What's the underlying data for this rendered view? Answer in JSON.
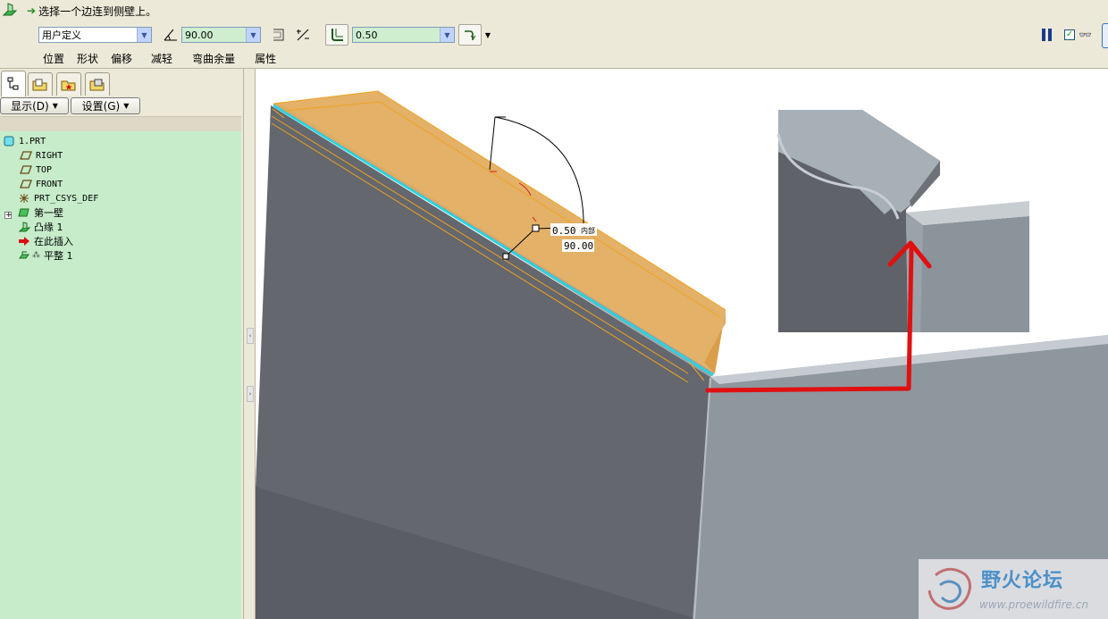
{
  "dashboard": {
    "prompt": "选择一个边连到侧壁上。",
    "shape_select": "用户定义",
    "angle_value": "90.00",
    "thickness_value": "0.50",
    "tabs": [
      "位置",
      "形状",
      "偏移",
      "减轻",
      "弯曲余量",
      "属性"
    ]
  },
  "navigator": {
    "show_button": "显示(D)",
    "settings_button": "设置(G)",
    "tree": [
      {
        "label": "1.PRT",
        "icon": "part-icon"
      },
      {
        "label": "RIGHT",
        "icon": "datum-plane-icon"
      },
      {
        "label": "TOP",
        "icon": "datum-plane-icon"
      },
      {
        "label": "FRONT",
        "icon": "datum-plane-icon"
      },
      {
        "label": "PRT_CSYS_DEF",
        "icon": "csys-icon"
      },
      {
        "label": "第一壁",
        "icon": "first-wall-icon"
      },
      {
        "label": "凸缘 1",
        "icon": "flange-icon"
      },
      {
        "label": "在此插入",
        "icon": "insert-arrow-icon"
      },
      {
        "label": "平整 1",
        "icon": "flat-wall-icon"
      }
    ]
  },
  "graphics": {
    "dim_thickness": "0.50",
    "dim_side": "内部",
    "dim_angle": "90.00",
    "watermark_title": "野火论坛",
    "watermark_url": "www.proewildfire.cn",
    "colors": {
      "preview": "#e2ad60",
      "wall_dark": "#63666c",
      "wall_light": "#8d959c",
      "highlight": "#23d7df",
      "annotation": "#e01010"
    }
  }
}
